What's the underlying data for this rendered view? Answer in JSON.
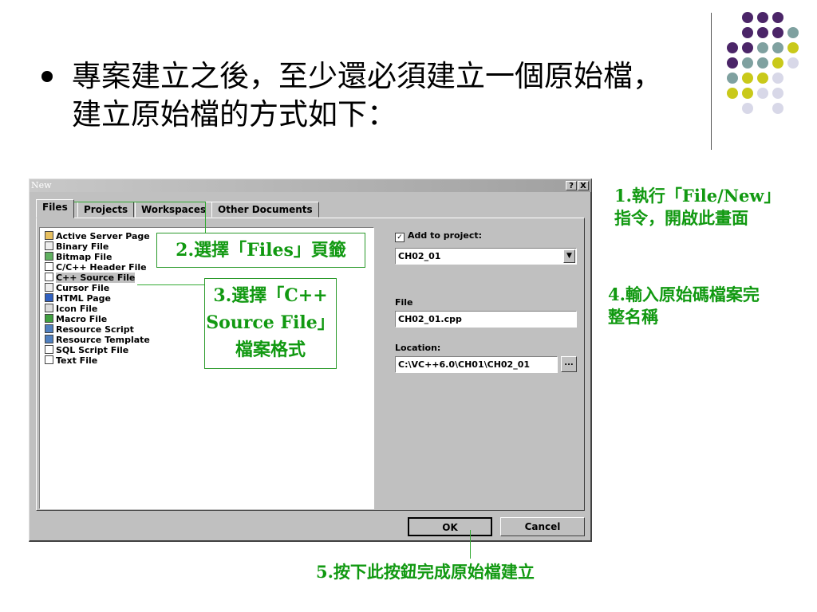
{
  "slide": {
    "bullet_line1": "專案建立之後，至少還必須建立一個原始檔，",
    "bullet_line2": "建立原始檔的方式如下："
  },
  "dialog": {
    "title": "New",
    "help_btn": "?",
    "close_btn": "X",
    "tabs": [
      "Files",
      "Projects",
      "Workspaces",
      "Other Documents"
    ],
    "files": [
      "Active Server Page",
      "Binary File",
      "Bitmap File",
      "C/C++ Header File",
      "C++ Source File",
      "Cursor File",
      "HTML Page",
      "Icon File",
      "Macro File",
      "Resource Script",
      "Resource Template",
      "SQL Script File",
      "Text File"
    ],
    "selected_file": "C++ Source File",
    "add_to_project_label": "Add to project:",
    "add_to_project_checked": true,
    "project_value": "CH02_01",
    "file_label": "File",
    "file_value": "CH02_01.cpp",
    "location_label": "Location:",
    "location_value": "C:\\VC++6.0\\CH01\\CH02_01",
    "browse_btn": "...",
    "ok_btn": "OK",
    "cancel_btn": "Cancel"
  },
  "callouts": {
    "c1_line1": "1.執行「File/New」",
    "c1_line2": "指令，開啟此畫面",
    "c2": "2.選擇「Files」頁籤",
    "c3_line1": "3.選擇「C++",
    "c3_line2": "Source File」",
    "c3_line3": "檔案格式",
    "c4_line1": "4.輸入原始碼檔案完",
    "c4_line2": "整名稱",
    "c5": "5.按下此按鈕完成原始檔建立"
  },
  "colors": {
    "callout_green": "#119911",
    "dot_purple": "#4b2568",
    "dot_teal": "#7fa1a0",
    "dot_yellow": "#c9c91a",
    "dot_lavender": "#d8d8e8"
  }
}
